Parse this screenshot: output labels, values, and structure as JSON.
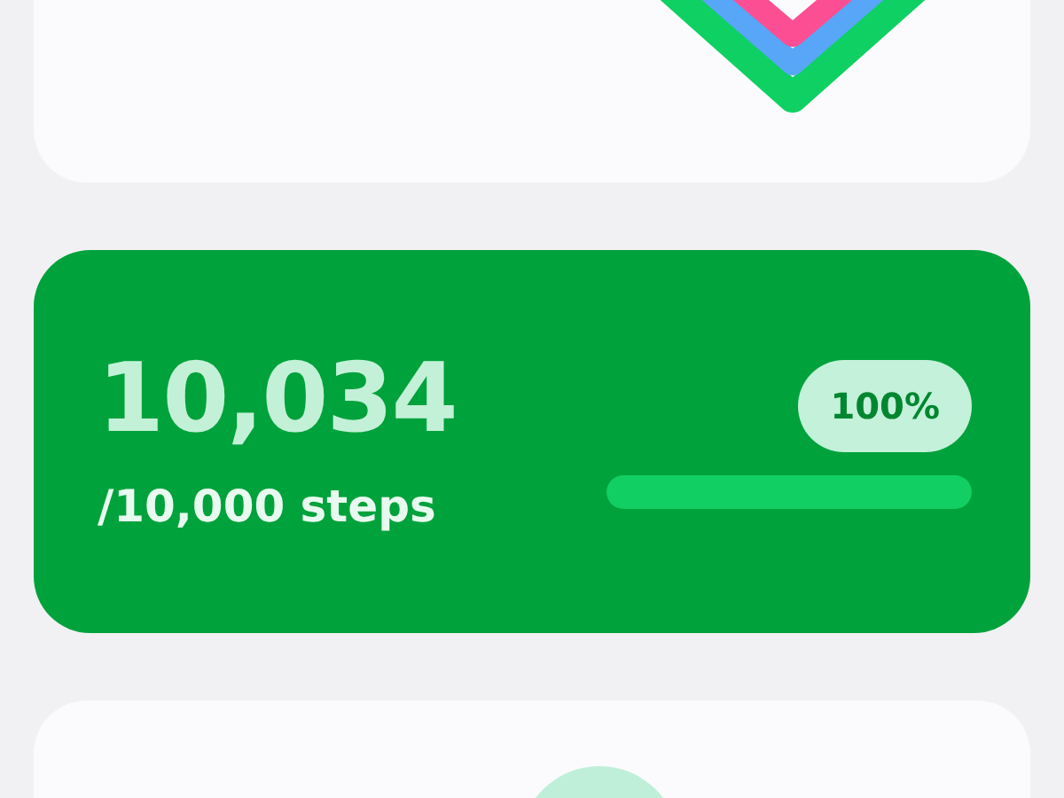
{
  "steps": {
    "count": "10,034",
    "goal": "/10,000 steps",
    "percent": "100%",
    "level": 1
  }
}
